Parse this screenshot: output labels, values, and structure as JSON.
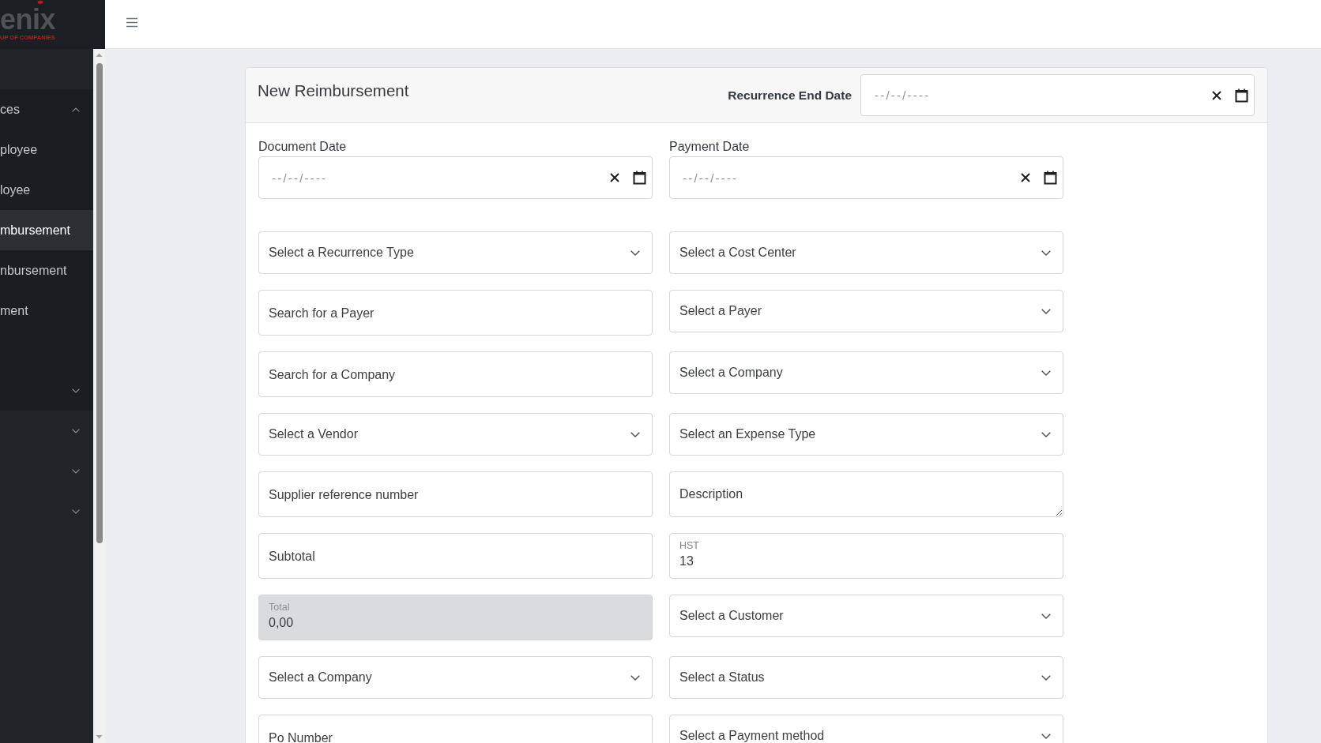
{
  "sidebar": {
    "logo": {
      "wordmark": "enix",
      "tagline": "UP OF COMPANIES"
    },
    "items": [
      {
        "kind": "group",
        "label": "ces",
        "expanded": true,
        "children": [
          {
            "kind": "link",
            "label": "ployee",
            "selected": false
          },
          {
            "kind": "link",
            "label": "loyee",
            "selected": false
          },
          {
            "kind": "link",
            "label": "mbursement",
            "selected": true
          },
          {
            "kind": "link",
            "label": "nbursement",
            "selected": false
          },
          {
            "kind": "link",
            "label": "ment",
            "selected": false
          },
          {
            "kind": "group",
            "expanded": false
          }
        ]
      },
      {
        "kind": "group",
        "expanded": false
      },
      {
        "kind": "group",
        "expanded": false
      },
      {
        "kind": "group",
        "expanded": false
      }
    ]
  },
  "form": {
    "title": "New Reimbursement",
    "recurrence_end_date": {
      "label": "Recurrence End Date",
      "placeholder": "--/--/----"
    },
    "fields": [
      {
        "kind": "date",
        "label": "Document Date",
        "placeholder": "--/--/----",
        "disabled": false
      },
      {
        "kind": "date",
        "label": "Payment Date",
        "placeholder": "--/--/----",
        "disabled": false
      },
      {
        "kind": "select",
        "placeholder": "Select a Recurrence Type",
        "disabled": false
      },
      {
        "kind": "select",
        "placeholder": "Select a Cost Center",
        "disabled": false
      },
      {
        "kind": "floating",
        "label": "Search for a Payer",
        "disabled": false
      },
      {
        "kind": "select",
        "placeholder": "Select a Payer",
        "disabled": false
      },
      {
        "kind": "floating",
        "label": "Search for a Company",
        "disabled": false
      },
      {
        "kind": "select",
        "placeholder": "Select a Company",
        "disabled": false
      },
      {
        "kind": "select",
        "placeholder": "Select a Vendor",
        "disabled": false
      },
      {
        "kind": "select",
        "placeholder": "Select an Expense Type",
        "disabled": false
      },
      {
        "kind": "floating",
        "label": "Supplier reference number",
        "disabled": false
      },
      {
        "kind": "textarea",
        "placeholder": "Description",
        "disabled": false
      },
      {
        "kind": "floating",
        "label": "Subtotal",
        "disabled": false
      },
      {
        "kind": "floating",
        "label": "HST",
        "value": "13",
        "disabled": false
      },
      {
        "kind": "floating",
        "label": "Total",
        "value": "0,00",
        "disabled": true
      },
      {
        "kind": "select",
        "placeholder": "Select a Customer",
        "disabled": false
      },
      {
        "kind": "select",
        "placeholder": "Select a Company",
        "disabled": false
      },
      {
        "kind": "select",
        "placeholder": "Select a Status",
        "disabled": false
      },
      {
        "kind": "floating",
        "label": "Po Number",
        "disabled": false
      },
      {
        "kind": "select",
        "placeholder": "Select a Payment method",
        "disabled": false
      }
    ]
  }
}
